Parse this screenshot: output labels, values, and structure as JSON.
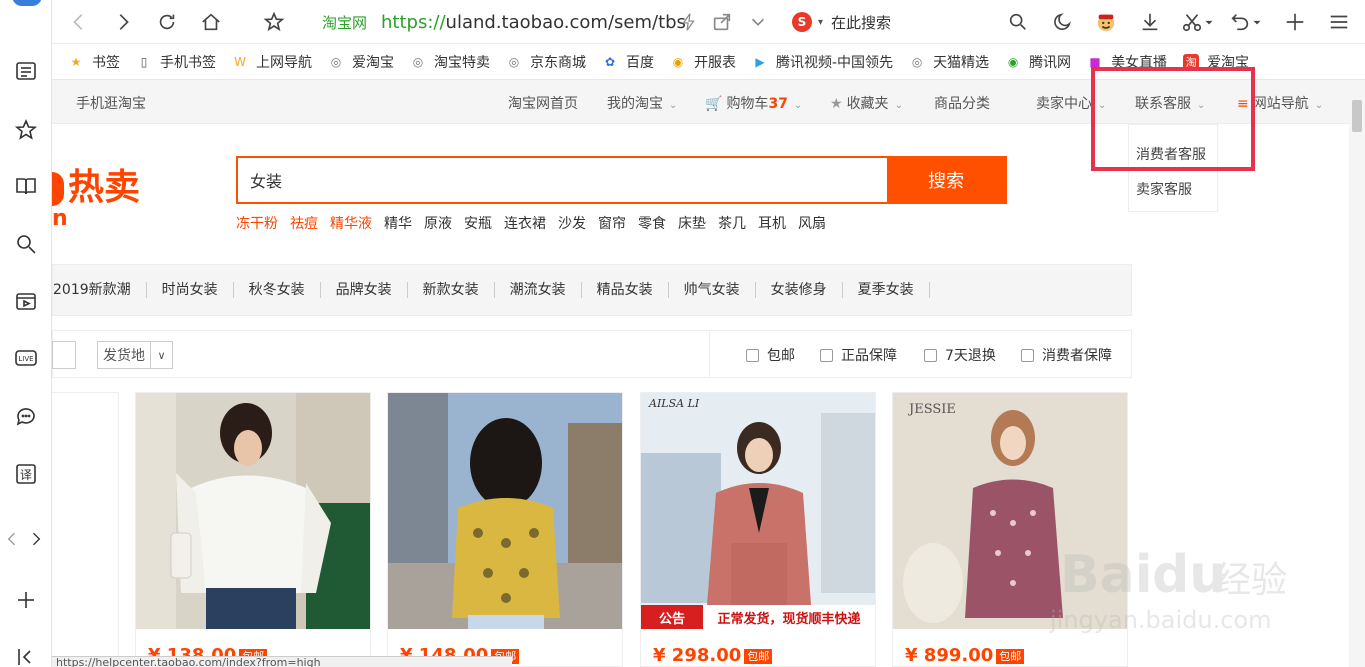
{
  "browser": {
    "url_site": "淘宝网",
    "url_proto": "https://",
    "url_rest": "uland.taobao.com/sem/tbs",
    "search_engine_logo": "S",
    "search_placeholder": "在此搜索",
    "bookmarks": [
      {
        "label": "书签",
        "icon": "star-icon"
      },
      {
        "label": "手机书签",
        "icon": "phone-icon"
      },
      {
        "label": "上网导航",
        "icon": "w-logo-icon"
      },
      {
        "label": "爱淘宝",
        "icon": "globe-icon"
      },
      {
        "label": "淘宝特卖",
        "icon": "globe-icon"
      },
      {
        "label": "京东商城",
        "icon": "globe-icon"
      },
      {
        "label": "百度",
        "icon": "paw-icon"
      },
      {
        "label": "开服表",
        "icon": "coin-icon"
      },
      {
        "label": "腾讯视频-中国领先",
        "icon": "play-icon"
      },
      {
        "label": "天猫精选",
        "icon": "globe-icon"
      },
      {
        "label": "腾讯网",
        "icon": "color-globe-icon"
      },
      {
        "label": "美女直播",
        "icon": "video-icon"
      },
      {
        "label": "爱淘宝",
        "icon": "tao-icon"
      }
    ],
    "status_url": "https://helpcenter.taobao.com/index?from=high"
  },
  "tb_nav": {
    "mobile": "手机逛淘宝",
    "home": "淘宝网首页",
    "my_taobao": "我的淘宝",
    "cart_label": "购物车",
    "cart_count": "37",
    "favorites": "收藏夹",
    "categories": "商品分类",
    "seller_center": "卖家中心",
    "contact_service": "联系客服",
    "site_nav": "网站导航"
  },
  "dropdown": {
    "items": [
      "消费者客服",
      "卖家客服"
    ]
  },
  "logo": {
    "text": "热卖",
    "sub": "n"
  },
  "search": {
    "value": "女装",
    "button": "搜索",
    "hot": [
      "冻干粉",
      "祛痘",
      "精华液",
      "精华",
      "原液",
      "安瓶",
      "连衣裙",
      "沙发",
      "窗帘",
      "零食",
      "床垫",
      "茶几",
      "耳机",
      "风扇"
    ],
    "hot_highlight_count": 3
  },
  "categories": [
    "2019新款潮",
    "时尚女装",
    "秋冬女装",
    "品牌女装",
    "新款女装",
    "潮流女装",
    "精品女装",
    "帅气女装",
    "女装修身",
    "夏季女装"
  ],
  "filters": {
    "ship_from": "发货地",
    "checks": [
      "包邮",
      "正品保障",
      "7天退换",
      "消费者保障"
    ]
  },
  "products": [
    {
      "price": "",
      "tag": ""
    },
    {
      "price": "¥ 138.00",
      "tag": "包邮"
    },
    {
      "price": "¥ 148.00",
      "tag": "包邮"
    },
    {
      "price": "¥ 298.00",
      "tag": "包邮",
      "brand": "AILSA LI",
      "notice_l": "公告",
      "notice_r": "正常发货，现货顺丰快递"
    },
    {
      "price": "¥ 899.00",
      "tag": "包邮",
      "brand": "JESSIE"
    }
  ],
  "watermark": {
    "brand": "Bai",
    "brand2": "du",
    "cn": "经验",
    "url": "jingyan.baidu.com"
  }
}
